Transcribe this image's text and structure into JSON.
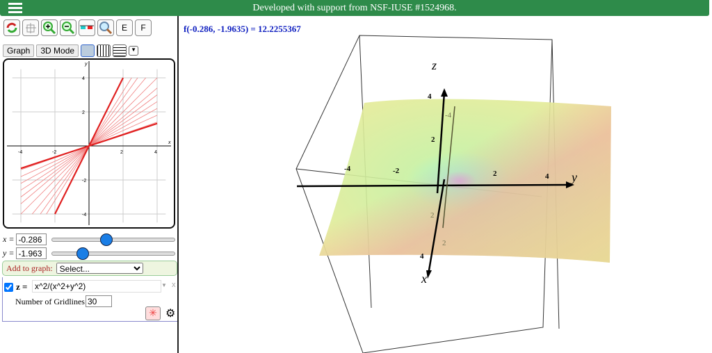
{
  "header": {
    "title": "Developed with support from NSF-IUSE #1524968."
  },
  "toolbar": {
    "e_label": "E",
    "f_label": "F"
  },
  "tabs": {
    "graph": "Graph",
    "mode3d": "3D Mode"
  },
  "plot2d": {
    "xticks": [
      "-4",
      "-2",
      "2",
      "4"
    ],
    "yticks": [
      "4",
      "2",
      "-2",
      "-4"
    ],
    "xlabel": "x",
    "ylabel": "y"
  },
  "sliders": {
    "x": {
      "label": "x =",
      "value": "-0.286",
      "fraction": 0.44
    },
    "y": {
      "label": "y =",
      "value": "-1.963",
      "fraction": 0.25
    }
  },
  "add_graph": {
    "label": "Add to graph:",
    "selected": "Select..."
  },
  "expression": {
    "label": "z =",
    "value": "x^2/(x^2+y^2)",
    "gridlines_label": "Number of Gridlines",
    "gridlines_value": "30",
    "close": "x"
  },
  "readout": "f(-0.286, -1.9635) = 12.2255367",
  "plot3d": {
    "x": "x",
    "y": "y",
    "z": "z",
    "ticks": {
      "y_neg4": "-4",
      "y_neg2": "-2",
      "y_2": "2",
      "y_4": "4",
      "z_4": "4",
      "z_2": "2",
      "x_neg4": "-4",
      "x_neg2": "2",
      "x_2": "2",
      "x_4": "4"
    }
  }
}
